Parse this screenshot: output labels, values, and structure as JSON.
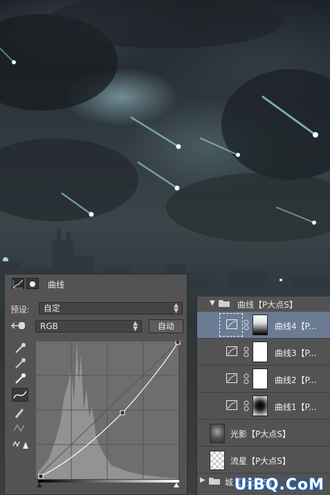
{
  "curves_panel": {
    "title": "曲线",
    "preset_label": "预设:",
    "preset_value": "自定",
    "channel_value": "RGB",
    "auto_button": "自动"
  },
  "layers_panel": {
    "group_open": {
      "name": "曲线【P大点S】"
    },
    "layers": [
      {
        "name": "曲线4【P...",
        "selected": true
      },
      {
        "name": "曲线3【P..."
      },
      {
        "name": "曲线2【P..."
      },
      {
        "name": "曲线1【P..."
      },
      {
        "name": "光影【P大点S】"
      },
      {
        "name": "流星【P大点S】"
      }
    ],
    "group_closed": {
      "name": "城【P大点S】"
    }
  },
  "watermark": "UiBQ.CoM",
  "colors": {
    "panel_bg": "#535353",
    "selected_row": "#6a7b93",
    "watermark_glow": "#1a6bd8"
  }
}
